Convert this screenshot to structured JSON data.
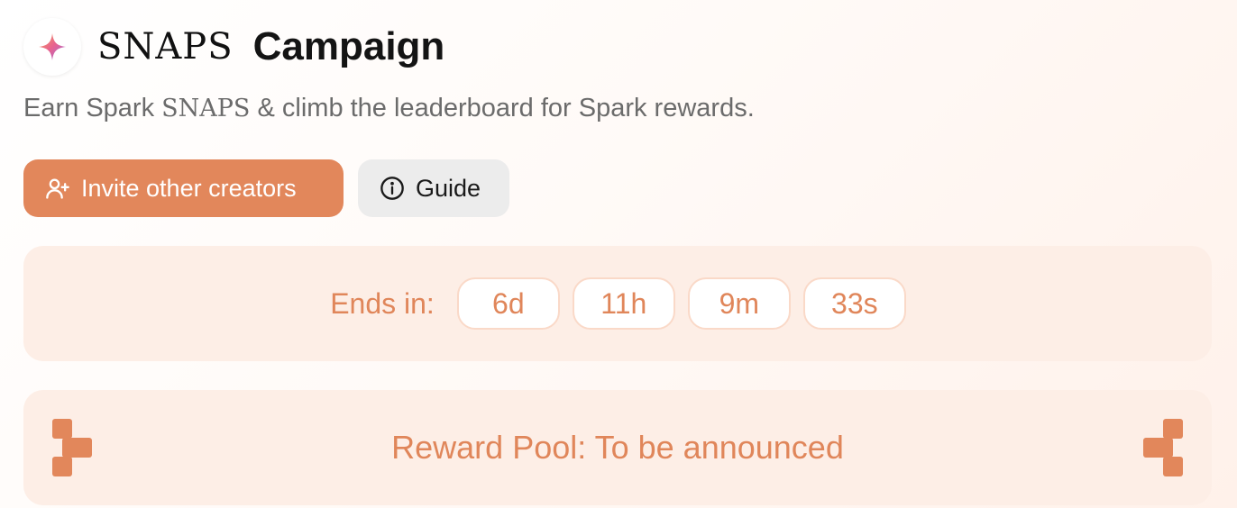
{
  "header": {
    "brand": "SNAPS",
    "title": "Campaign",
    "logo_icon": "sparkle-icon"
  },
  "subtitle": {
    "before": "Earn Spark ",
    "brand": "SNAPS",
    "after": " & climb the leaderboard for Spark rewards."
  },
  "actions": {
    "invite_label": "Invite other creators",
    "invite_icon": "user-plus-icon",
    "guide_label": "Guide",
    "guide_icon": "info-icon"
  },
  "countdown": {
    "label": "Ends in:",
    "days": "6d",
    "hours": "11h",
    "minutes": "9m",
    "seconds": "33s"
  },
  "reward_pool": {
    "text": "Reward Pool: To be announced",
    "decoration_icon": "pixel-bracket-icon"
  },
  "colors": {
    "accent": "#e2875b",
    "card_bg": "#fdeee6",
    "guide_bg": "#ececec",
    "subtitle": "#6b6b6b"
  }
}
